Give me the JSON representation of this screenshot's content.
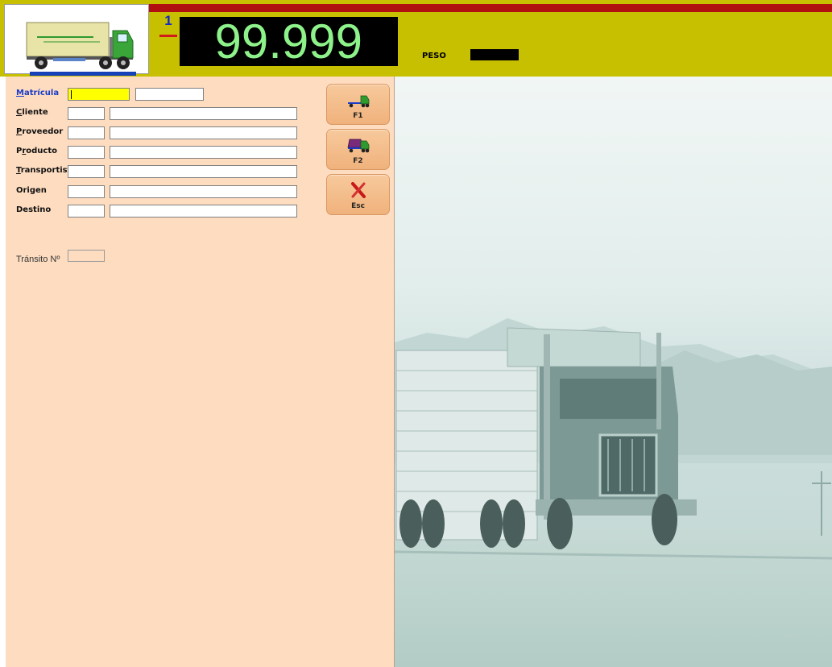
{
  "header": {
    "scale_number": "1",
    "weight_display": "99.999",
    "peso_label": "PESO",
    "colors": {
      "topbar": "#c6c000",
      "accent_red": "#b11010",
      "display_bg": "#000000",
      "display_text": "#8df28a"
    }
  },
  "form": {
    "fields": [
      {
        "label": "Matrícula",
        "accel": "M",
        "rest": "atrícula",
        "code": "",
        "value": ""
      },
      {
        "label": "Cliente",
        "accel": "C",
        "rest": "liente",
        "code": "",
        "value": ""
      },
      {
        "label": "Proveedor",
        "accel": "P",
        "rest": "roveedor",
        "code": "",
        "value": ""
      },
      {
        "label": "Producto",
        "accel": "r",
        "pre": "P",
        "rest": "oducto",
        "code": "",
        "value": ""
      },
      {
        "label": "Transportista",
        "accel": "T",
        "rest": "ransportista",
        "code": "",
        "value": ""
      },
      {
        "label": "Origen",
        "code": "",
        "value": ""
      },
      {
        "label": "Destino",
        "code": "",
        "value": ""
      }
    ],
    "transit_label": "Tránsito Nº",
    "transit_value": ""
  },
  "buttons": [
    {
      "key": "F1",
      "icon": "truck-entry-icon"
    },
    {
      "key": "F2",
      "icon": "truck-loaded-icon"
    },
    {
      "key": "Esc",
      "icon": "close-x-icon"
    }
  ],
  "panel_colors": {
    "form_bg": "#fddcc0",
    "button_bg": "#f0b27c",
    "active_field": "#ffff00",
    "active_label": "#1a3cc8"
  }
}
